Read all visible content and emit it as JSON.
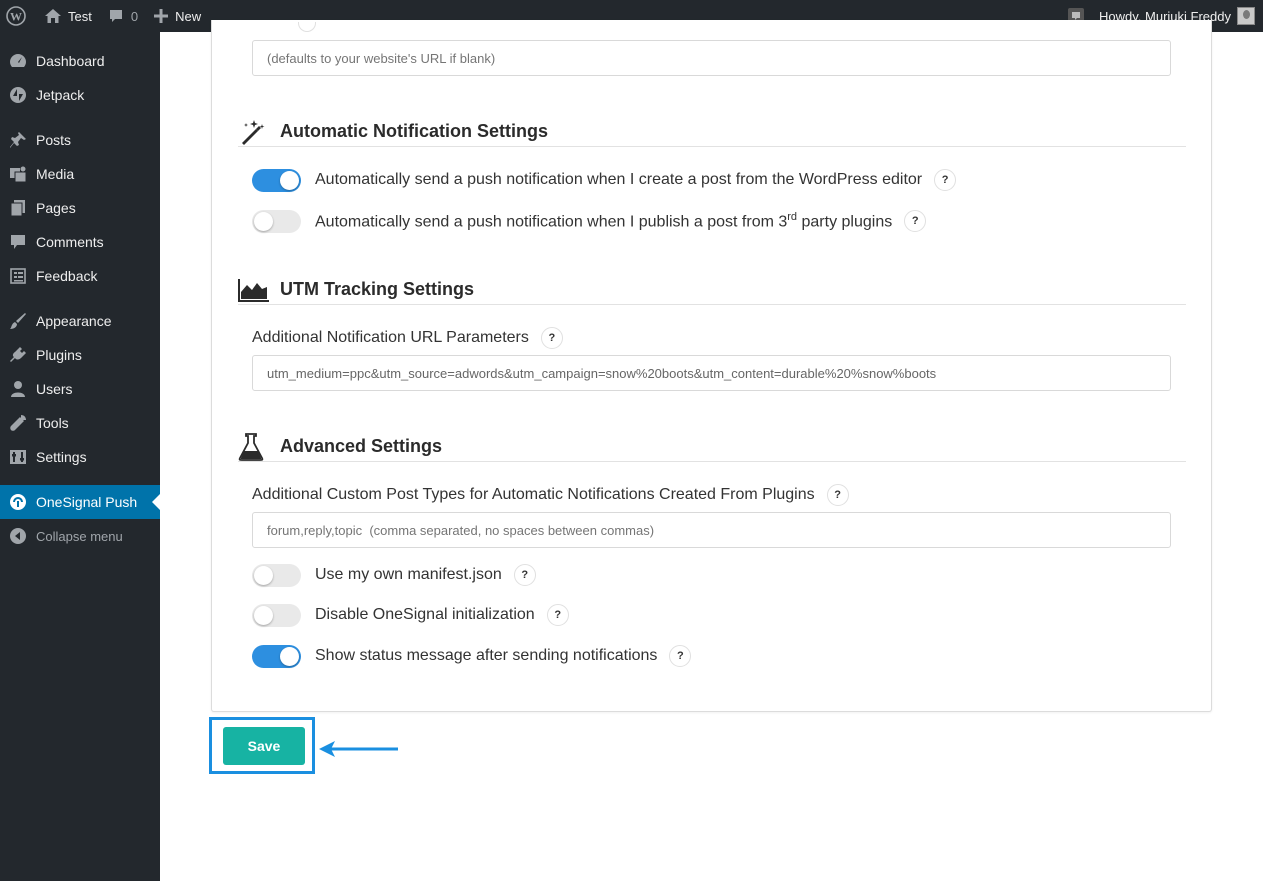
{
  "adminbar": {
    "site_name": "Test",
    "comments_count": "0",
    "new_label": "New",
    "greeting": "Howdy, Muriuki Freddy"
  },
  "sidebar": {
    "items": [
      {
        "label": "Dashboard",
        "icon": "dashboard-icon"
      },
      {
        "label": "Jetpack",
        "icon": "jetpack-icon"
      },
      {
        "label": "Posts",
        "icon": "pin-icon"
      },
      {
        "label": "Media",
        "icon": "media-icon"
      },
      {
        "label": "Pages",
        "icon": "pages-icon"
      },
      {
        "label": "Comments",
        "icon": "comment-icon"
      },
      {
        "label": "Feedback",
        "icon": "feedback-icon"
      },
      {
        "label": "Appearance",
        "icon": "paintbrush-icon"
      },
      {
        "label": "Plugins",
        "icon": "plugin-icon"
      },
      {
        "label": "Users",
        "icon": "user-icon"
      },
      {
        "label": "Tools",
        "icon": "wrench-icon"
      },
      {
        "label": "Settings",
        "icon": "settings-icon"
      },
      {
        "label": "OneSignal Push",
        "icon": "onesignal-icon"
      },
      {
        "label": "Collapse menu",
        "icon": "collapse-icon"
      }
    ]
  },
  "site_url": {
    "placeholder": "(defaults to your website's URL if blank)"
  },
  "automatic": {
    "title": "Automatic Notification Settings",
    "opt1": "Automatically send a push notification when I create a post from the WordPress editor",
    "opt1_on": true,
    "opt2_pre": "Automatically send a push notification when I publish a post from 3",
    "opt2_sup": "rd",
    "opt2_post": " party plugins",
    "opt2_on": false
  },
  "utm": {
    "title": "UTM Tracking Settings",
    "label": "Additional Notification URL Parameters",
    "value": "utm_medium=ppc&utm_source=adwords&utm_campaign=snow%20boots&utm_content=durable%20%snow%boots"
  },
  "advanced": {
    "title": "Advanced Settings",
    "label": "Additional Custom Post Types for Automatic Notifications Created From Plugins",
    "value": "forum,reply,topic  (comma separated, no spaces between commas)",
    "opt_manifest": "Use my own manifest.json",
    "opt_disable": "Disable OneSignal initialization",
    "opt_status": "Show status message after sending notifications"
  },
  "help_glyph": "?",
  "save_label": "Save"
}
